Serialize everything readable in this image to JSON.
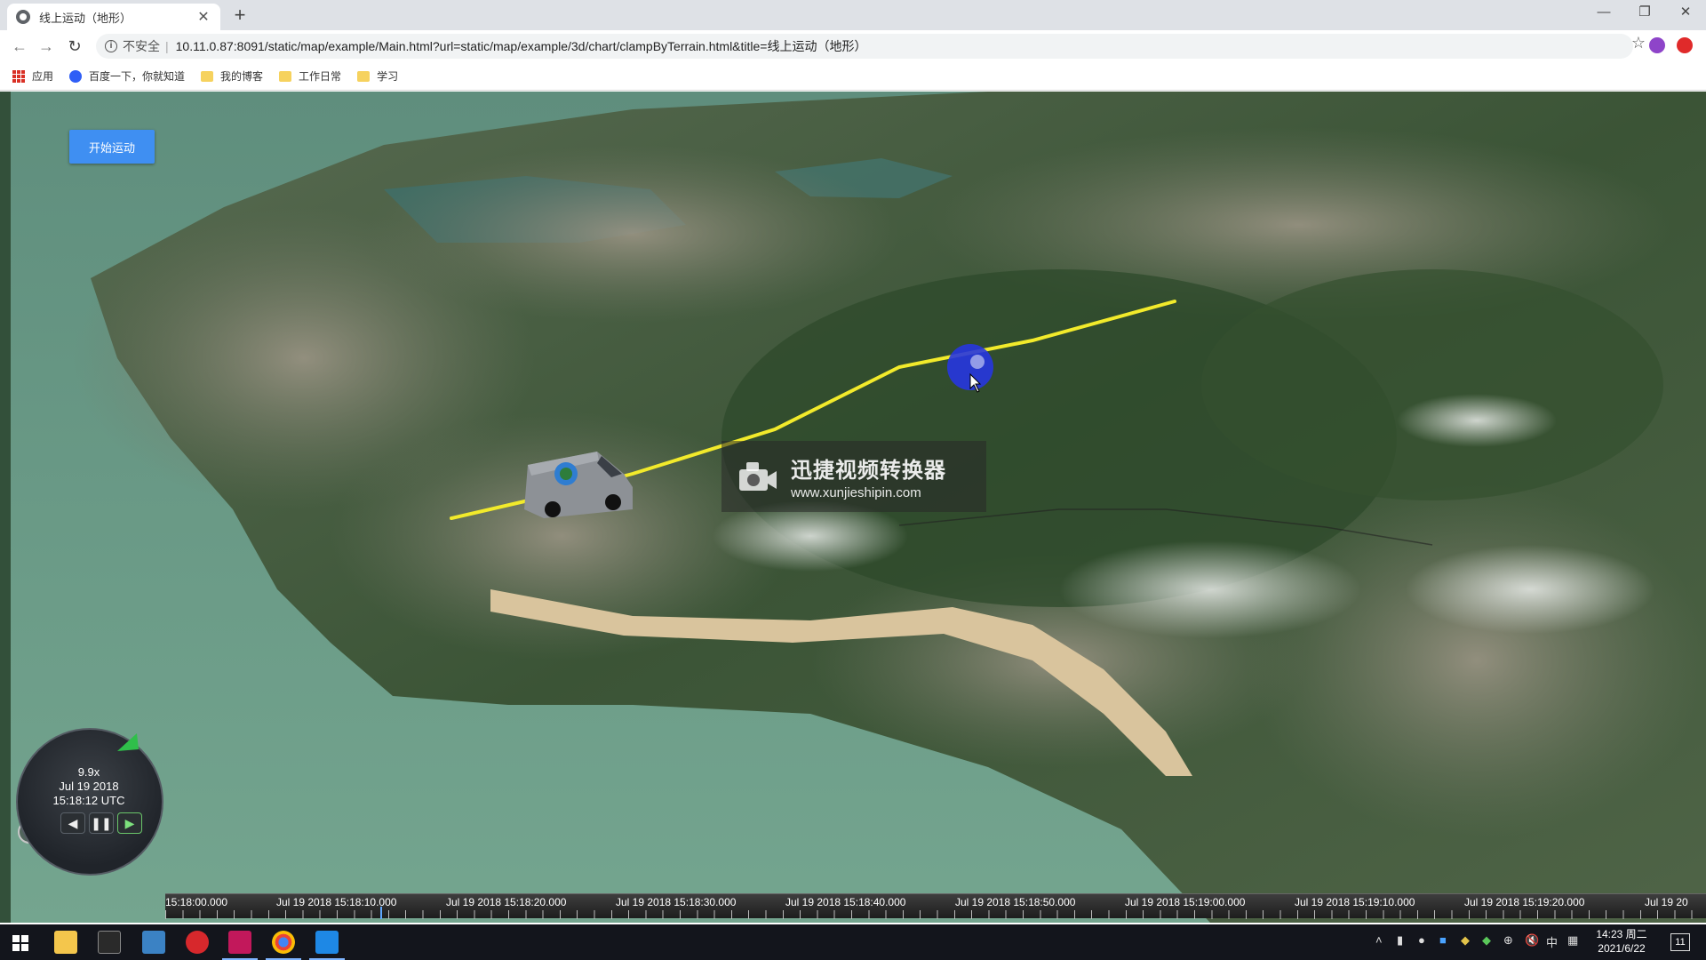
{
  "browser": {
    "tab_title": "线上运动（地形）",
    "tab_close": "✕",
    "new_tab": "+",
    "window_controls": {
      "minimize": "—",
      "restore": "❐",
      "close": "✕"
    },
    "security_label": "不安全",
    "url": "10.11.0.87:8091/static/map/example/Main.html?url=static/map/example/3d/chart/clampByTerrain.html&title=线上运动（地形）",
    "bookmarks": [
      {
        "label": "应用",
        "icon": "apps-grid-icon"
      },
      {
        "label": "百度一下，你就知道",
        "icon": "baidu-paw-icon"
      },
      {
        "label": "我的博客",
        "icon": "folder-icon"
      },
      {
        "label": "工作日常",
        "icon": "folder-icon"
      },
      {
        "label": "学习",
        "icon": "folder-icon"
      }
    ]
  },
  "page": {
    "start_button_label": "开始运动",
    "watermark": {
      "line1": "迅捷视频转换器",
      "line2": "www.xunjieshipin.com"
    }
  },
  "animation": {
    "speed": "9.9x",
    "date": "Jul 19 2018",
    "time": "15:18:12 UTC",
    "buttons": {
      "reverse": "◀",
      "pause": "❚❚",
      "play": "▶"
    }
  },
  "timeline": {
    "labels": [
      "15:18:00.000",
      "Jul 19 2018 15:18:10.000",
      "Jul 19 2018 15:18:20.000",
      "Jul 19 2018 15:18:30.000",
      "Jul 19 2018 15:18:40.000",
      "Jul 19 2018 15:18:50.000",
      "Jul 19 2018 15:19:00.000",
      "Jul 19 2018 15:19:10.000",
      "Jul 19 2018 15:19:20.000",
      "Jul 19 20"
    ]
  },
  "taskbar": {
    "tray_labels": {
      "ime": "中",
      "volume": "🔇"
    },
    "time": "14:23 周二",
    "date": "2021/6/22",
    "notification_count": "11"
  },
  "colors": {
    "route_line": "#f2ea2b",
    "start_button": "#3f8ff2",
    "sea": "#6c9a87",
    "land": "#3f5a3c"
  }
}
